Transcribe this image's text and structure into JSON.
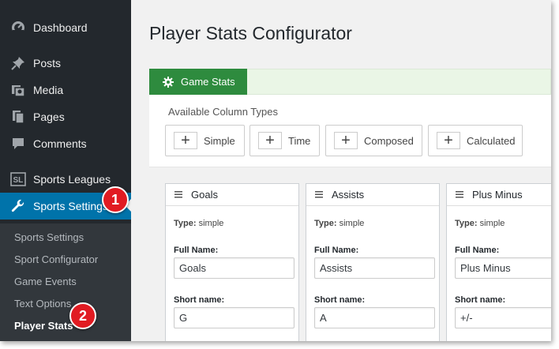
{
  "sidebar": {
    "items": [
      {
        "label": "Dashboard",
        "icon": "dashboard-icon"
      },
      {
        "label": "Posts",
        "icon": "pin-icon"
      },
      {
        "label": "Media",
        "icon": "media-icon"
      },
      {
        "label": "Pages",
        "icon": "pages-icon"
      },
      {
        "label": "Comments",
        "icon": "comments-icon"
      },
      {
        "label": "Sports Leagues",
        "icon": "sl-logo-icon"
      },
      {
        "label": "Sports Settings",
        "icon": "wrench-icon"
      }
    ],
    "submenu": [
      "Sports Settings",
      "Sport Configurator",
      "Game Events",
      "Text Options",
      "Player Stats"
    ],
    "accent_color": "#0073aa"
  },
  "badges": [
    "1",
    "2"
  ],
  "page": {
    "title": "Player Stats Configurator",
    "tab_label": "Game Stats",
    "tab_color": "#2e8b3e"
  },
  "column_types": {
    "label": "Available Column Types",
    "buttons": [
      "Simple",
      "Time",
      "Composed",
      "Calculated"
    ]
  },
  "cards": [
    {
      "title": "Goals",
      "type_label": "Type:",
      "type_value": "simple",
      "full_name_label": "Full Name:",
      "full_name": "Goals",
      "short_name_label": "Short name:",
      "short_name": "G"
    },
    {
      "title": "Assists",
      "type_label": "Type:",
      "type_value": "simple",
      "full_name_label": "Full Name:",
      "full_name": "Assists",
      "short_name_label": "Short name:",
      "short_name": "A"
    },
    {
      "title": "Plus Minus",
      "type_label": "Type:",
      "type_value": "simple",
      "full_name_label": "Full Name:",
      "full_name": "Plus Minus",
      "short_name_label": "Short name:",
      "short_name": "+/-"
    }
  ]
}
